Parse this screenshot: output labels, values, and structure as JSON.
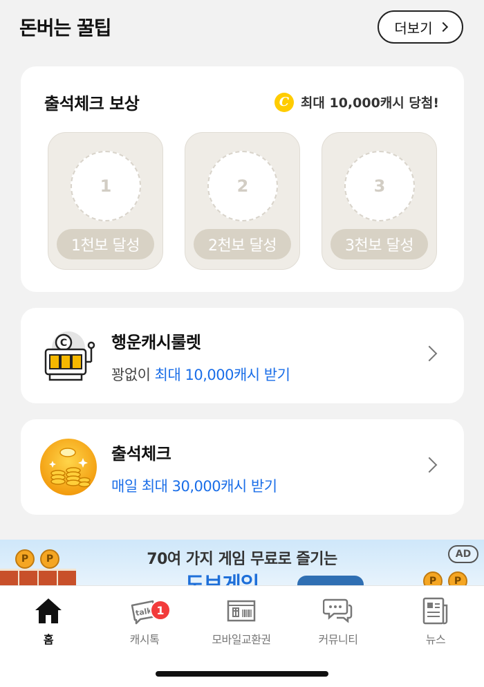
{
  "header": {
    "title": "돈버는 꿀팁",
    "more_label": "더보기"
  },
  "attendance_reward": {
    "title": "출석체크 보상",
    "max_text": "최대 10,000캐시 당첨!",
    "coin_symbol": "C",
    "steps": [
      {
        "number": "1",
        "label": "1천보 달성"
      },
      {
        "number": "2",
        "label": "2천보 달성"
      },
      {
        "number": "3",
        "label": "3천보 달성"
      }
    ]
  },
  "roulette": {
    "title": "행운캐시룰렛",
    "sub_prefix": "꽝없이",
    "sub_highlight": "최대 10,000캐시 받기",
    "icon": "slot-machine-icon"
  },
  "attendance": {
    "title": "출석체크",
    "sub_highlight": "매일 최대 30,000캐시 받기",
    "icon": "gold-coins-icon"
  },
  "ad": {
    "text": "70여 가지 게임 무료로 즐기는",
    "logo_text": "도브게임",
    "badge": "AD",
    "coin_symbol": "P"
  },
  "tabbar": {
    "tabs": [
      {
        "label": "홈",
        "icon": "home-icon",
        "active": true
      },
      {
        "label": "캐시톡",
        "icon": "talk-icon",
        "badge": "1"
      },
      {
        "label": "모바일교환권",
        "icon": "gift-card-icon"
      },
      {
        "label": "커뮤니티",
        "icon": "chat-bubbles-icon"
      },
      {
        "label": "뉴스",
        "icon": "news-icon"
      }
    ]
  },
  "colors": {
    "accent_blue": "#1a6ee8",
    "coin_yellow": "#ffcc00",
    "badge_red": "#f23b3b"
  }
}
